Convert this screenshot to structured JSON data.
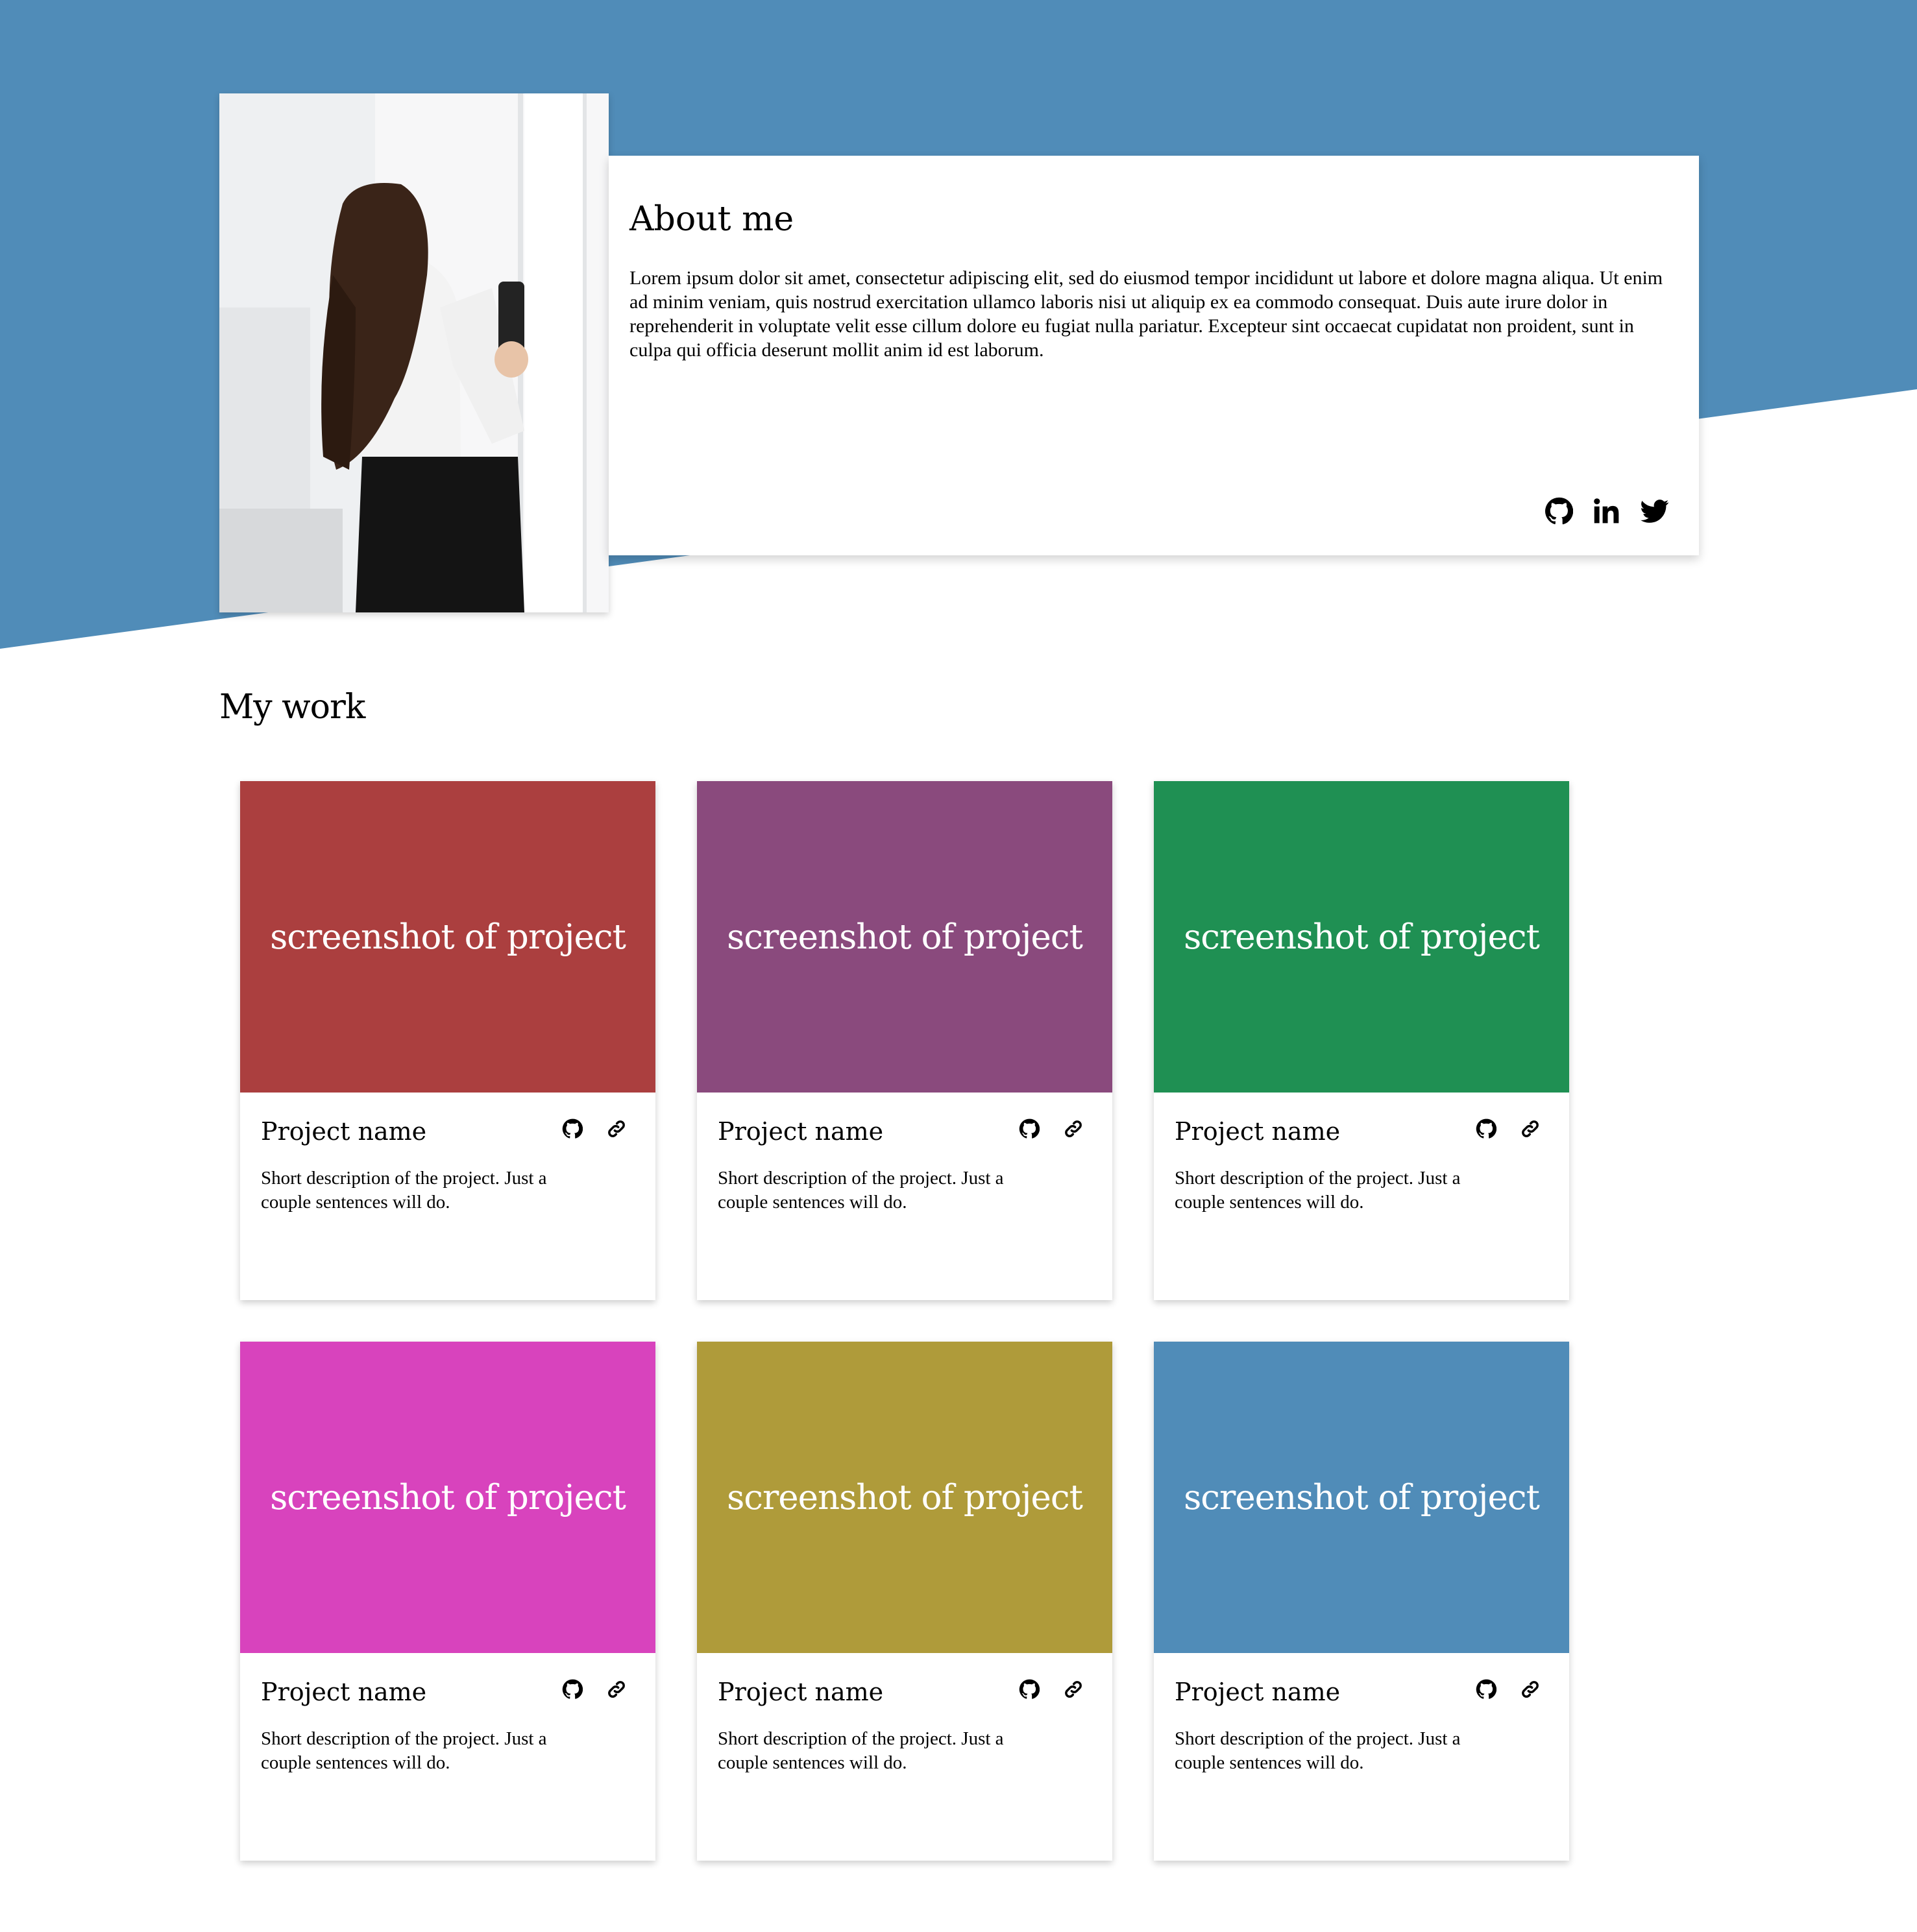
{
  "about": {
    "title": "About me",
    "body": "Lorem ipsum dolor sit amet, consectetur adipiscing elit, sed do eiusmod tempor incididunt ut labore et dolore magna aliqua. Ut enim ad minim veniam, quis nostrud exercitation ullamco laboris nisi ut aliquip ex ea commodo consequat. Duis aute irure dolor in reprehenderit in voluptate velit esse cillum dolore eu fugiat nulla pariatur. Excepteur sint occaecat cupidatat non proident, sunt in culpa qui officia deserunt mollit anim id est laborum.",
    "socials": [
      "github-icon",
      "linkedin-icon",
      "twitter-icon"
    ]
  },
  "work": {
    "title": "My work",
    "projects": [
      {
        "screenshot": "screenshot of project",
        "name": "Project name",
        "description": "Short description of the project. Just a couple sentences will do.",
        "color": "#ab3f3f"
      },
      {
        "screenshot": "screenshot of project",
        "name": "Project name",
        "description": "Short description of the project. Just a couple sentences will do.",
        "color": "#8a4a7d"
      },
      {
        "screenshot": "screenshot of project",
        "name": "Project name",
        "description": "Short description of the project. Just a couple sentences will do.",
        "color": "#1f9053"
      },
      {
        "screenshot": "screenshot of project",
        "name": "Project name",
        "description": "Short description of the project. Just a couple sentences will do.",
        "color": "#d843bd"
      },
      {
        "screenshot": "screenshot of project",
        "name": "Project name",
        "description": "Short description of the project. Just a couple sentences will do.",
        "color": "#af9b3a"
      },
      {
        "screenshot": "screenshot of project",
        "name": "Project name",
        "description": "Short description of the project. Just a couple sentences will do.",
        "color": "#508cb8"
      }
    ]
  },
  "colors": {
    "hero": "#508cb8"
  }
}
